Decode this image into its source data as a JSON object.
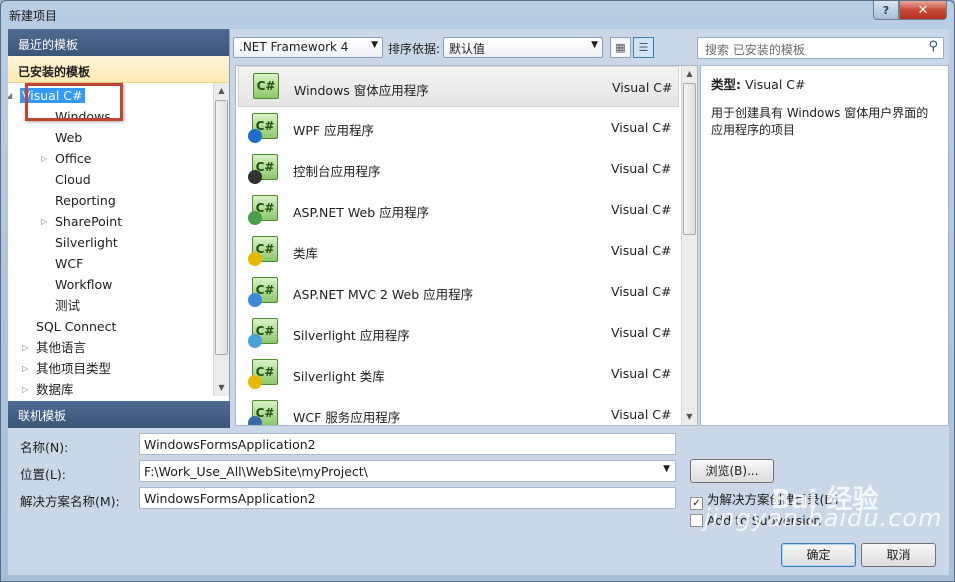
{
  "window": {
    "title": "新建项目",
    "help": "?",
    "close": "✕"
  },
  "left": {
    "recent_header": "最近的模板",
    "installed_header": "已安装的模板",
    "online_header": "联机模板",
    "tree": [
      {
        "label": "Visual C#",
        "selected": true,
        "expander": "◢"
      },
      {
        "label": "Windows"
      },
      {
        "label": "Web"
      },
      {
        "label": "Office",
        "expander": "▷"
      },
      {
        "label": "Cloud"
      },
      {
        "label": "Reporting"
      },
      {
        "label": "SharePoint",
        "expander": "▷"
      },
      {
        "label": "Silverlight"
      },
      {
        "label": "WCF"
      },
      {
        "label": "Workflow"
      },
      {
        "label": "测试"
      },
      {
        "label": "SQL Connect"
      },
      {
        "label": "其他语言",
        "expander": "▷"
      },
      {
        "label": "其他项目类型",
        "expander": "▷"
      },
      {
        "label": "数据库",
        "expander": "▷"
      }
    ]
  },
  "toolbar": {
    "framework": ".NET Framework 4",
    "sort_label": "排序依据:",
    "sort_value": "默认值",
    "search_placeholder": "搜索 已安装的模板"
  },
  "templates": [
    {
      "name": "Windows 窗体应用程序",
      "lang": "Visual C#",
      "icon": "windows-forms-icon"
    },
    {
      "name": "WPF 应用程序",
      "lang": "Visual C#",
      "icon": "wpf-icon"
    },
    {
      "name": "控制台应用程序",
      "lang": "Visual C#",
      "icon": "console-icon"
    },
    {
      "name": "ASP.NET Web 应用程序",
      "lang": "Visual C#",
      "icon": "aspnet-web-icon"
    },
    {
      "name": "类库",
      "lang": "Visual C#",
      "icon": "class-library-icon"
    },
    {
      "name": "ASP.NET MVC 2 Web 应用程序",
      "lang": "Visual C#",
      "icon": "aspnet-mvc-icon"
    },
    {
      "name": "Silverlight 应用程序",
      "lang": "Visual C#",
      "icon": "silverlight-app-icon"
    },
    {
      "name": "Silverlight 类库",
      "lang": "Visual C#",
      "icon": "silverlight-library-icon"
    },
    {
      "name": "WCF 服务应用程序",
      "lang": "Visual C#",
      "icon": "wcf-service-icon"
    }
  ],
  "info": {
    "type_label": "类型:",
    "type_value": "Visual C#",
    "description": "用于创建具有 Windows 窗体用户界面的应用程序的项目"
  },
  "form": {
    "name_label": "名称(N):",
    "name_value": "WindowsFormsApplication2",
    "location_label": "位置(L):",
    "location_value": "F:\\Work_Use_All\\WebSite\\myProject\\",
    "solution_label": "解决方案名称(M):",
    "solution_value": "WindowsFormsApplication2",
    "browse": "浏览(B)...",
    "create_dir": "为解决方案创建目录(D)",
    "create_dir_checked": true,
    "source_control": "Add to Subversion",
    "source_control_checked": false,
    "ok": "确定",
    "cancel": "取消"
  },
  "watermark": {
    "text": "jingyan.baidu.com",
    "logo": "Bai 经验"
  }
}
